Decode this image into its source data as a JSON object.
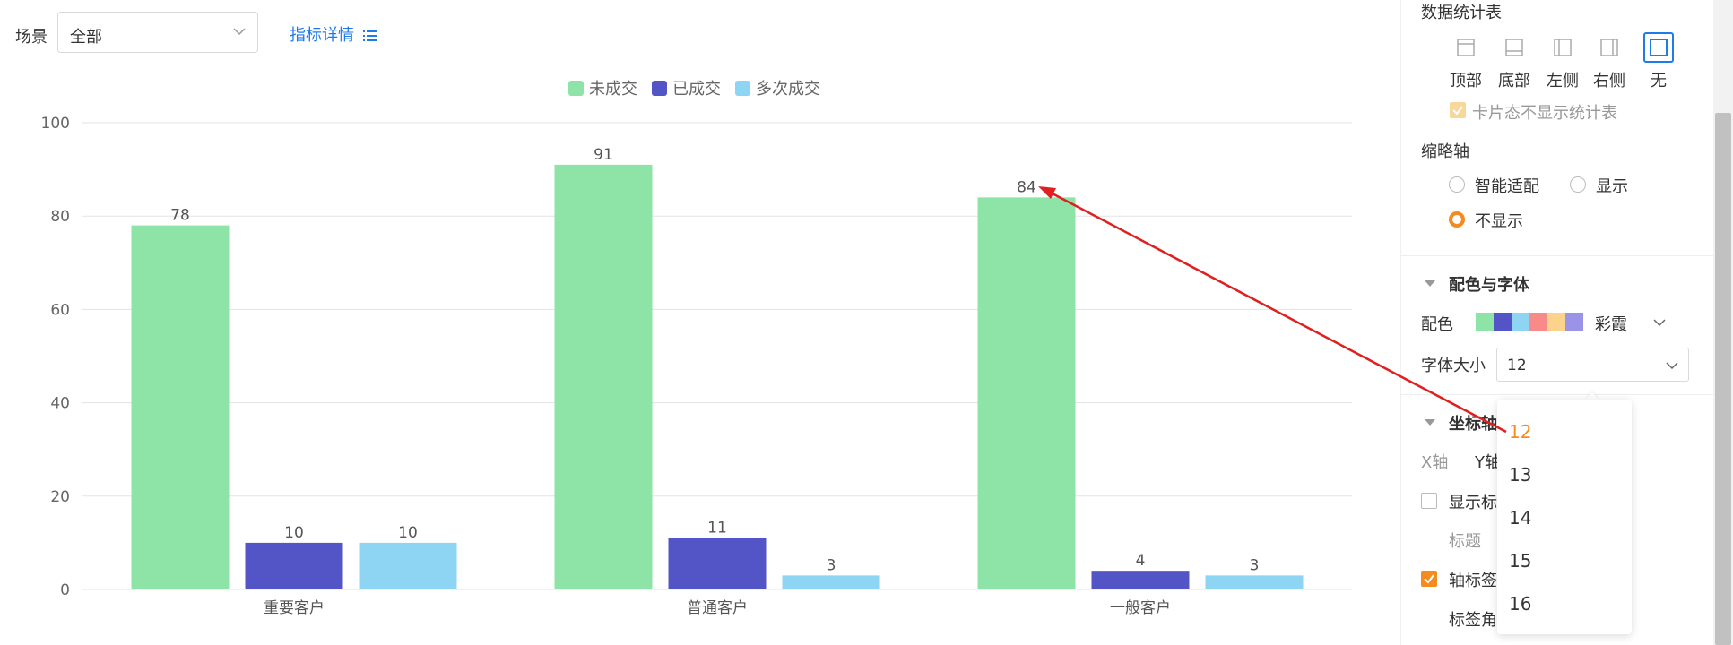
{
  "filter": {
    "scene_label": "场景",
    "scene_value": "全部",
    "indicator_link": "指标详情"
  },
  "chart_data": {
    "type": "bar",
    "categories": [
      "重要客户",
      "普通客户",
      "一般客户"
    ],
    "series": [
      {
        "name": "未成交",
        "values": [
          78,
          91,
          84
        ],
        "color": "#8ee4a6"
      },
      {
        "name": "已成交",
        "values": [
          10,
          11,
          4
        ],
        "color": "#5355c6"
      },
      {
        "name": "多次成交",
        "values": [
          10,
          3,
          3
        ],
        "color": "#8dd5f2"
      }
    ],
    "ylim": [
      0,
      100
    ],
    "yticks": [
      0,
      20,
      40,
      60,
      80,
      100
    ],
    "grid": true,
    "legend": "top-center",
    "data_labels": true
  },
  "panel": {
    "stats_table_title": "数据统计表",
    "positions": [
      {
        "label": "顶部",
        "icon": "layout-top-icon"
      },
      {
        "label": "底部",
        "icon": "layout-bottom-icon"
      },
      {
        "label": "左侧",
        "icon": "layout-left-icon"
      },
      {
        "label": "右侧",
        "icon": "layout-right-icon"
      },
      {
        "label": "无",
        "icon": "layout-none-icon",
        "selected": true
      }
    ],
    "card_hide_stats": "卡片态不显示统计表",
    "thumbnail_axis": {
      "title": "缩略轴",
      "options": [
        "智能适配",
        "显示",
        "不显示"
      ],
      "selected": "不显示"
    },
    "color_font": {
      "title": "配色与字体",
      "palette_label": "配色",
      "palette_name": "彩霞",
      "palette_colors": [
        "#8ee4a6",
        "#5355c6",
        "#8dd5f2",
        "#f88a8a",
        "#fbd38d",
        "#9b93e8"
      ],
      "font_size_label": "字体大小",
      "font_size_value": "12"
    },
    "axis": {
      "title": "坐标轴",
      "tab_x": "X轴",
      "tab_y": "Y轴",
      "show_title_label": "显示标",
      "title_label": "标题",
      "axis_label": "轴标签",
      "label_angle": "标签角"
    },
    "font_size_options": [
      "12",
      "13",
      "14",
      "15",
      "16"
    ],
    "font_size_selected": "12"
  },
  "colors": {
    "accent": "#f58b1f",
    "link": "#1f7aec",
    "annotation_arrow": "#e02020"
  }
}
